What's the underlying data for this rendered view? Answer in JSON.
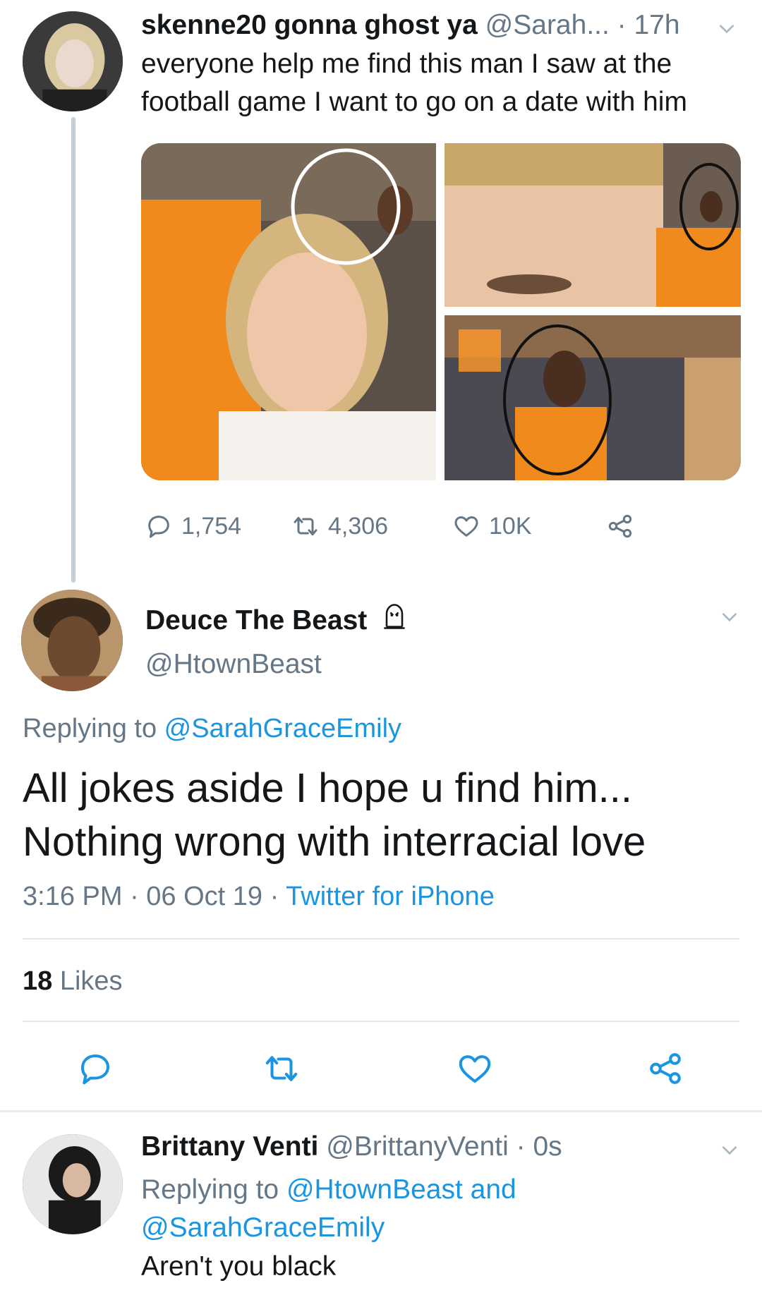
{
  "tweet1": {
    "display_name": "skenne20 gonna ghost ya",
    "handle": "@Sarah...",
    "time": "· 17h",
    "text": "everyone help me find this man I saw at the football game I want to go on a date with him",
    "stats": {
      "replies": "1,754",
      "retweets": "4,306",
      "likes": "10K"
    }
  },
  "tweet2": {
    "display_name": "Deuce The Beast",
    "handle": "@HtownBeast",
    "replying_prefix": "Replying to ",
    "replying_to": "@SarahGraceEmily",
    "text": "All jokes aside I hope u find him... Nothing wrong with interracial love",
    "timestamp": "3:16 PM · 06 Oct 19 · ",
    "source": "Twitter for iPhone",
    "likes_count": "18",
    "likes_label": " Likes"
  },
  "tweet3": {
    "display_name": "Brittany Venti",
    "handle": "@BrittanyVenti",
    "time": "· 0s",
    "replying_prefix": "Replying to ",
    "replying_to": "@HtownBeast and @SarahGraceEmily",
    "text": "Aren't you black"
  },
  "colors": {
    "link": "#1b95e0",
    "muted": "#657786",
    "accent_orange": "#f28a1a"
  }
}
